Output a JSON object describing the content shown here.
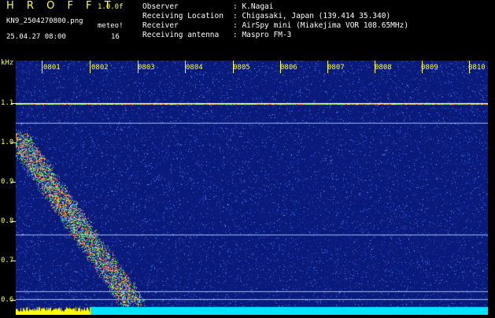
{
  "header": {
    "logo": "H R O F F T",
    "version": "1.0.0f",
    "filename": "KN9_2504270800.png",
    "meteor_label": "meteo!",
    "datetime": "25.04.27 08:00",
    "meteor_count": "16",
    "fields": [
      {
        "label": "Observer",
        "value": ": K.Nagai"
      },
      {
        "label": "Receiving Location",
        "value": ": Chigasaki, Japan (139.414 35.340)"
      },
      {
        "label": "Receiver",
        "value": ": AirSpy mini (Miakejima VOR 108.65MHz)"
      },
      {
        "label": "Receiving antenna",
        "value": ": Maspro FM-3"
      }
    ]
  },
  "spectrogram": {
    "y_unit": "kHz",
    "y_ticks": [
      "1.1",
      "1.0",
      "0.9",
      "0.8",
      "0.7",
      "0.6"
    ],
    "x_ticks": [
      "0801",
      "0802",
      "0803",
      "0804",
      "0805",
      "0806",
      "0807",
      "0808",
      "0809",
      "0810"
    ],
    "colors": {
      "background": "#0a1a7a",
      "noise": "#2a4fd0",
      "carrier": "#ff5050",
      "trail": "#ffcc33",
      "bottom_band": "#00e5ff",
      "bottom_left": "#ffff00"
    }
  }
}
